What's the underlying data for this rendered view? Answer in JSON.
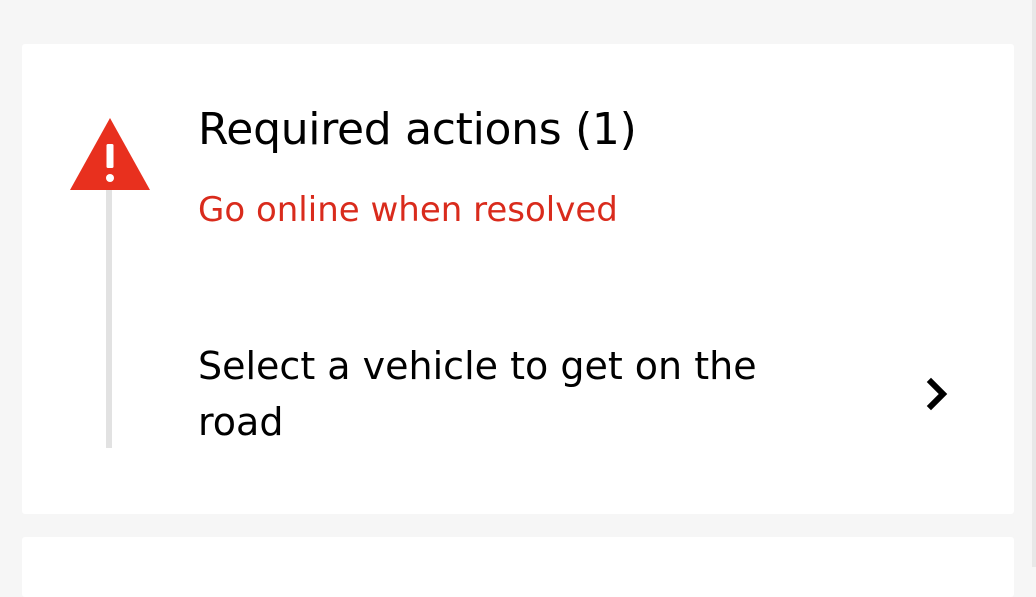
{
  "required_actions": {
    "title": "Required actions (1)",
    "subtitle": "Go online when resolved",
    "items": [
      {
        "label": "Select a vehicle to get on the road"
      }
    ]
  },
  "colors": {
    "warning": "#e8301e",
    "subtitle": "#d92b1c",
    "timeline": "#e2e2e2",
    "background": "#f6f6f6",
    "card": "#ffffff"
  },
  "icons": {
    "warning": "warning-triangle-icon",
    "chevron": "chevron-right-icon"
  }
}
